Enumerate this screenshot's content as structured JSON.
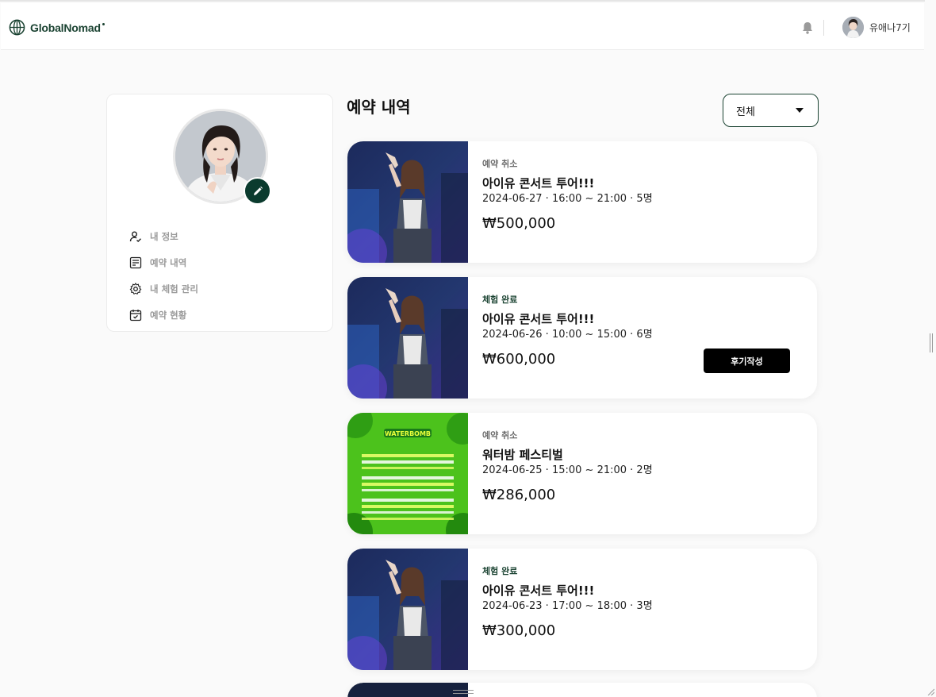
{
  "header": {
    "logo_text": "GlobalNomad",
    "brand_color": "#1b4332",
    "user_name": "유애나7기",
    "icons": [
      "globe-logo-icon",
      "bell-icon",
      "user-avatar"
    ]
  },
  "sidebar": {
    "items": [
      {
        "label": "내 정보",
        "icon": "user-check-icon"
      },
      {
        "label": "예약 내역",
        "icon": "list-icon"
      },
      {
        "label": "내 체험 관리",
        "icon": "gear-icon"
      },
      {
        "label": "예약 현황",
        "icon": "calendar-check-icon"
      }
    ],
    "edit_icon": "pencil-icon"
  },
  "main": {
    "title": "예약 내역",
    "filter": {
      "selected": "전체"
    },
    "reservations": [
      {
        "status": "예약 취소",
        "status_color": "#6b6b6b",
        "title": "아이유 콘서트 투어!!!",
        "meta": "2024-06-27 · 16:00 ~ 21:00 · 5명",
        "price": "₩500,000",
        "image": "concert"
      },
      {
        "status": "체험 완료",
        "status_color": "#1b4332",
        "title": "아이유 콘서트 투어!!!",
        "meta": "2024-06-26 · 10:00 ~ 15:00 · 6명",
        "price": "₩600,000",
        "image": "concert",
        "action": "후기작성"
      },
      {
        "status": "예약 취소",
        "status_color": "#6b6b6b",
        "title": "워터밤 페스티벌",
        "meta": "2024-06-25 · 15:00 ~ 21:00 · 2명",
        "price": "₩286,000",
        "image": "festival",
        "poster_title": "WATERBOMB"
      },
      {
        "status": "체험 완료",
        "status_color": "#1b4332",
        "title": "아이유 콘서트 투어!!!",
        "meta": "2024-06-23 · 17:00 ~ 18:00 · 3명",
        "price": "₩300,000",
        "image": "concert"
      }
    ]
  }
}
